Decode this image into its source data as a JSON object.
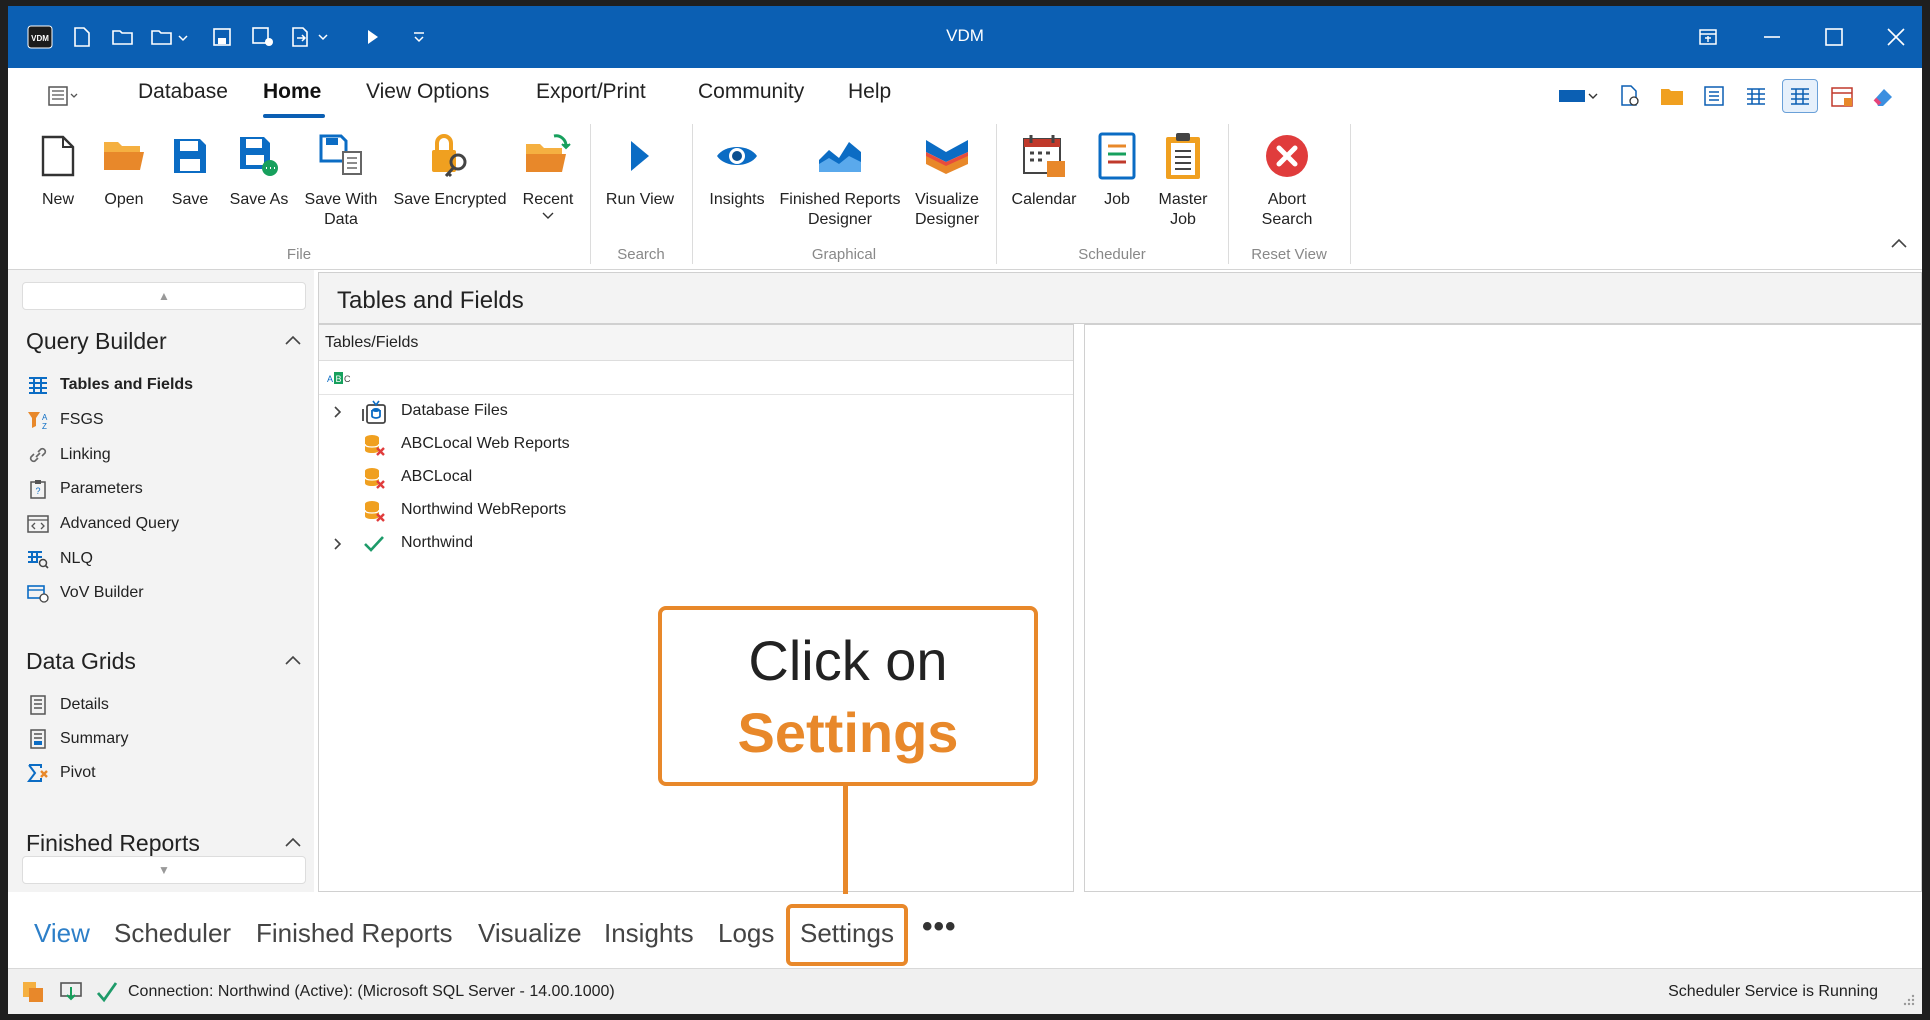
{
  "window": {
    "title": "VDM",
    "logo_text": "VDM"
  },
  "menu": {
    "items": [
      "Database",
      "Home",
      "View Options",
      "Export/Print",
      "Community",
      "Help"
    ],
    "active": "Home"
  },
  "ribbon": {
    "file": {
      "group_label": "File",
      "buttons": [
        "New",
        "Open",
        "Save",
        "Save As",
        "Save With\nData",
        "Save Encrypted",
        "Recent"
      ]
    },
    "search": {
      "group_label": "Search",
      "buttons": [
        "Run View"
      ]
    },
    "graphical": {
      "group_label": "Graphical",
      "buttons": [
        "Insights",
        "Finished Reports\nDesigner",
        "Visualize\nDesigner"
      ]
    },
    "scheduler": {
      "group_label": "Scheduler",
      "buttons": [
        "Calendar",
        "Job",
        "Master\nJob"
      ]
    },
    "reset_view": {
      "group_label": "Reset View",
      "buttons": [
        "Abort\nSearch"
      ]
    }
  },
  "sidebar": {
    "query_builder": {
      "title": "Query Builder",
      "items": [
        "Tables and Fields",
        "FSGS",
        "Linking",
        "Parameters",
        "Advanced Query",
        "NLQ",
        "VoV Builder"
      ],
      "active": "Tables and Fields"
    },
    "data_grids": {
      "title": "Data Grids",
      "items": [
        "Details",
        "Summary",
        "Pivot"
      ]
    },
    "finished_reports": {
      "title": "Finished Reports"
    }
  },
  "main": {
    "title": "Tables and Fields",
    "tree_header": "Tables/Fields",
    "tree_items": [
      {
        "label": "Database Files",
        "expandable": true,
        "icon": "database-files-icon"
      },
      {
        "label": "ABCLocal Web Reports",
        "expandable": false,
        "icon": "database-error-icon"
      },
      {
        "label": "ABCLocal",
        "expandable": false,
        "icon": "database-error-icon"
      },
      {
        "label": "Northwind WebReports",
        "expandable": false,
        "icon": "database-error-icon"
      },
      {
        "label": "Northwind",
        "expandable": true,
        "icon": "check-icon"
      }
    ]
  },
  "callout": {
    "line1": "Click on",
    "line2": "Settings"
  },
  "bottom_tabs": {
    "items": [
      "View",
      "Scheduler",
      "Finished Reports",
      "Visualize",
      "Insights",
      "Logs",
      "Settings"
    ],
    "active": "View",
    "highlighted": "Settings",
    "more": "•••"
  },
  "status": {
    "connection": "Connection: Northwind (Active): (Microsoft SQL Server - 14.00.1000)",
    "scheduler": "Scheduler Service is Running"
  },
  "colors": {
    "title_bar": "#0b5fb3",
    "accent_orange": "#e8882a",
    "active_tab": "#2d7fc8"
  }
}
